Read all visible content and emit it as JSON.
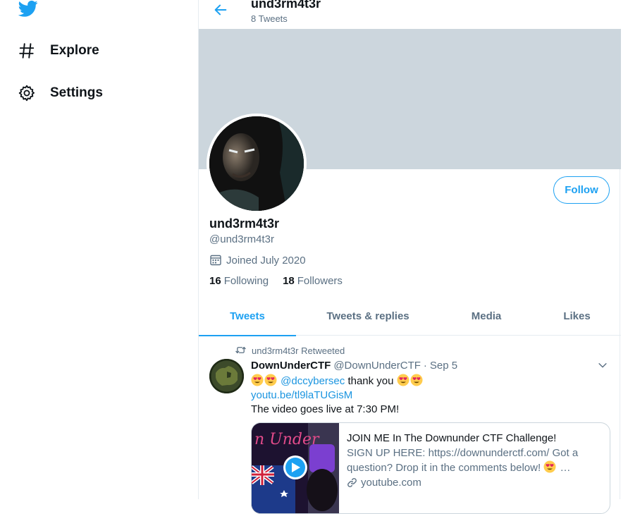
{
  "nav": {
    "items": [
      {
        "label": "Explore",
        "icon": "hashtag-icon"
      },
      {
        "label": "Settings",
        "icon": "gear-icon"
      }
    ]
  },
  "header": {
    "name": "und3rm4t3r",
    "tweet_count": "8 Tweets"
  },
  "profile": {
    "name": "und3rm4t3r",
    "handle": "@und3rm4t3r",
    "joined": "Joined July 2020",
    "following_count": "16",
    "following_label": "Following",
    "followers_count": "18",
    "followers_label": "Followers",
    "follow_button": "Follow"
  },
  "tabs": [
    {
      "label": "Tweets",
      "active": true
    },
    {
      "label": "Tweets & replies",
      "active": false
    },
    {
      "label": "Media",
      "active": false
    },
    {
      "label": "Likes",
      "active": false
    }
  ],
  "tweet": {
    "retweet_context": "und3rm4t3r Retweeted",
    "author_name": "DownUnderCTF",
    "author_handle": "@DownUnderCTF",
    "separator": "·",
    "date": "Sep 5",
    "mention": "@dccybersec",
    "thanks": "thank you",
    "short_link": "youtu.be/tl9laTUGisM",
    "line2": "The video goes live at 7:30 PM!",
    "card": {
      "title": "JOIN ME In The Downunder CTF Challenge!",
      "desc_a": "SIGN UP HERE: https://downunderctf.com/ Got a question? Drop it in the comments below!",
      "desc_b": "…",
      "source": "youtube.com",
      "thumb_text": "n Under"
    }
  },
  "colors": {
    "accent": "#1da1f2",
    "banner": "#ccd6dd",
    "secondary_text": "#5b7083"
  }
}
